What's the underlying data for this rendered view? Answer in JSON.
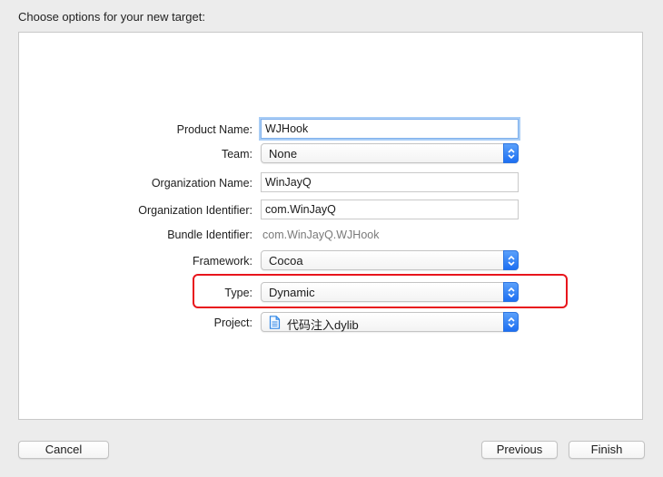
{
  "dialog": {
    "heading": "Choose options for your new target:"
  },
  "form": {
    "product_name": {
      "label": "Product Name:",
      "value": "WJHook"
    },
    "team": {
      "label": "Team:",
      "value": "None"
    },
    "organization_name": {
      "label": "Organization Name:",
      "value": "WinJayQ"
    },
    "organization_identifier": {
      "label": "Organization Identifier:",
      "value": "com.WinJayQ"
    },
    "bundle_identifier": {
      "label": "Bundle Identifier:",
      "value": "com.WinJayQ.WJHook"
    },
    "framework": {
      "label": "Framework:",
      "value": "Cocoa"
    },
    "type": {
      "label": "Type:",
      "value": "Dynamic"
    },
    "project": {
      "label": "Project:",
      "value": "代码注入dylib",
      "icon": "document-icon"
    }
  },
  "buttons": {
    "cancel": "Cancel",
    "previous": "Previous",
    "finish": "Finish"
  },
  "colors": {
    "accent_blue": "#1d6ff2",
    "highlight_red": "#e8151c",
    "focus_ring": "#a8cdf6"
  }
}
